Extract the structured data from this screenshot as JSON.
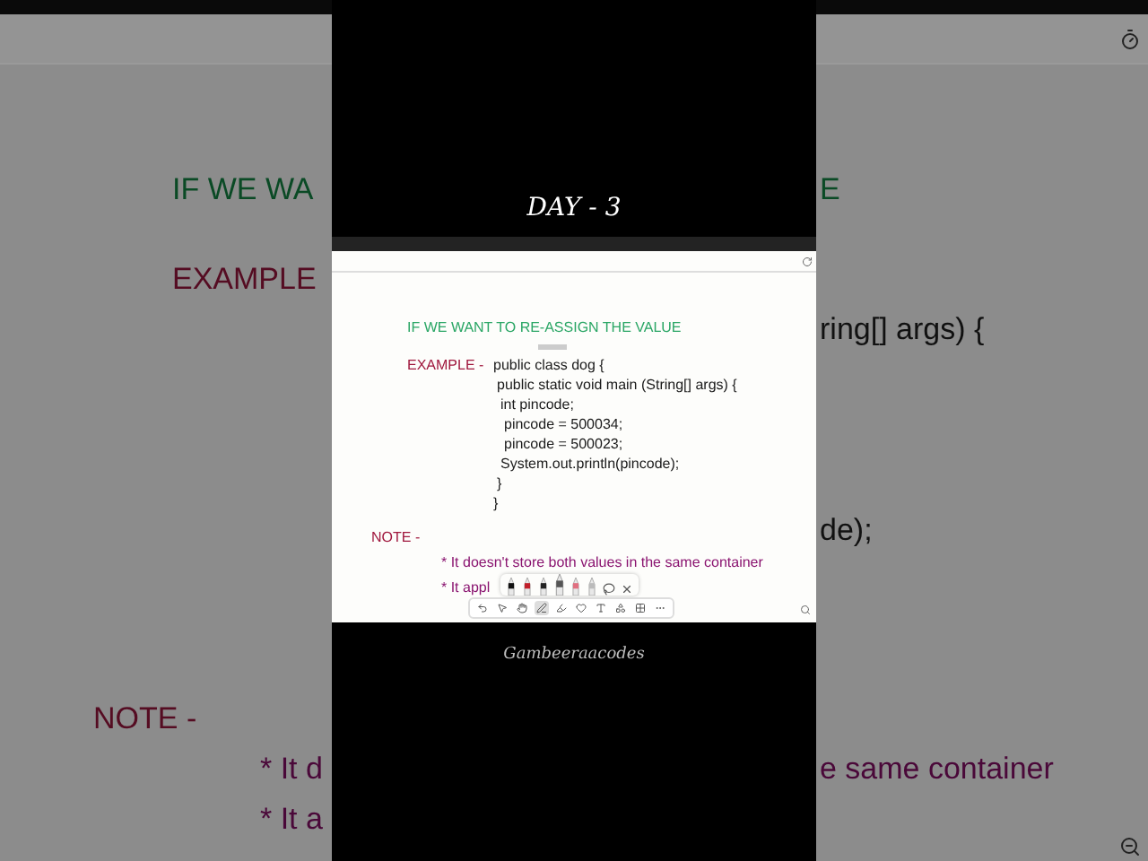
{
  "background": {
    "left_lines": [
      {
        "text": "IF WE WA",
        "kind": "heading"
      },
      {
        "text": "EXAMPLE",
        "kind": "example"
      },
      {
        "text": "NOTE -",
        "kind": "note"
      },
      {
        "text": "* It d",
        "kind": "bullet"
      },
      {
        "text": "* It a",
        "kind": "bullet"
      }
    ],
    "right_lines": [
      {
        "text": "E",
        "kind": "heading"
      },
      {
        "text": "ring[] args) {",
        "kind": "code"
      },
      {
        "text": "de);",
        "kind": "code"
      },
      {
        "text": "e same container",
        "kind": "bullet"
      }
    ]
  },
  "video": {
    "title": "DAY - 3",
    "caption": "Gambeeraacodes"
  },
  "board": {
    "heading": "IF WE WANT TO RE-ASSIGN THE VALUE",
    "example_label": "EXAMPLE -",
    "code": [
      {
        "text": "public class dog {",
        "children": [
          {
            "text": "public static void main (String[] args) {",
            "children": [
              {
                "text": "int  pincode;",
                "children": [
                  {
                    "text": "pincode = 500034;"
                  },
                  {
                    "text": "pincode = 500023;"
                  }
                ]
              },
              {
                "text": "System.out.println(pincode);"
              }
            ]
          },
          {
            "text": "}"
          }
        ]
      },
      {
        "text": "}"
      }
    ],
    "note_label": "NOTE -",
    "bullets": [
      "* It doesn't store both values in the same container",
      "* It appl"
    ],
    "pens": [
      {
        "color": "#111111",
        "selected": false
      },
      {
        "color": "#c0202a",
        "selected": false
      },
      {
        "color": "#222222",
        "selected": false
      },
      {
        "color": "#555555",
        "selected": true
      },
      {
        "color": "#e07080",
        "selected": false
      },
      {
        "color": "#bbbbbb",
        "selected": false
      }
    ],
    "tools": [
      {
        "kind": "undo",
        "selected": false
      },
      {
        "kind": "select",
        "selected": false
      },
      {
        "kind": "hand",
        "selected": false
      },
      {
        "kind": "pen",
        "selected": true
      },
      {
        "kind": "highlighter",
        "selected": false
      },
      {
        "kind": "heart",
        "selected": false
      },
      {
        "kind": "text",
        "selected": false
      },
      {
        "kind": "shapes",
        "selected": false
      },
      {
        "kind": "grid",
        "selected": false
      },
      {
        "kind": "more",
        "selected": false
      }
    ]
  }
}
